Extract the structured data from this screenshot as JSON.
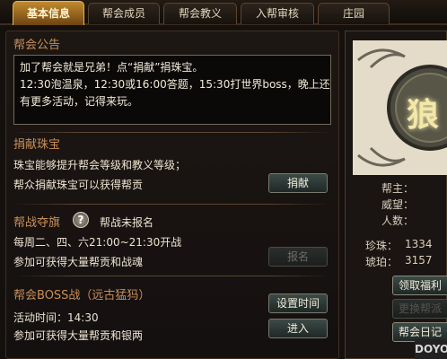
{
  "tabs": [
    {
      "label": "基本信息",
      "active": true
    },
    {
      "label": "帮会成员",
      "active": false
    },
    {
      "label": "帮会教义",
      "active": false
    },
    {
      "label": "入帮审核",
      "active": false
    },
    {
      "label": "庄园",
      "active": false
    }
  ],
  "announcement": {
    "title": "帮会公告",
    "lines": [
      "加了帮会就是兄弟！点“捐献”捐珠宝。",
      "12:30泡温泉，12:30或16:00答题，15:30打世界boss，晚上还",
      "有更多活动，记得来玩。"
    ]
  },
  "donate": {
    "title": "捐献珠宝",
    "line1": "珠宝能够提升帮会等级和教义等级；",
    "line2": "帮众捐献珠宝可以获得帮贡",
    "button": "捐献"
  },
  "flag_war": {
    "title": "帮战夺旗",
    "status": "帮战未报名",
    "schedule": "每周二、四、六21:00~21:30开战",
    "reward": "参加可获得大量帮贡和战魂",
    "button": "报名",
    "button_enabled": false,
    "help_glyph": "?"
  },
  "boss": {
    "title": "帮会BOSS战（远古猛犸）",
    "time": "活动时间：14:30",
    "reward": "参加可获得大量帮贡和银两",
    "set_time_button": "设置时间",
    "enter_button": "进入"
  },
  "guild_info": {
    "emblem_glyph": "狼",
    "leader_label": "帮主：",
    "prestige_label": "威望：",
    "members_label": "人数：",
    "pearl_label": "珍珠：",
    "pearl_value": "1334",
    "amber_label": "琥珀：",
    "amber_value": "3157"
  },
  "right_buttons": {
    "welfare": "领取福利",
    "disabled_label": "更换帮派",
    "log": "帮会日记"
  },
  "watermark": "DOYO"
}
